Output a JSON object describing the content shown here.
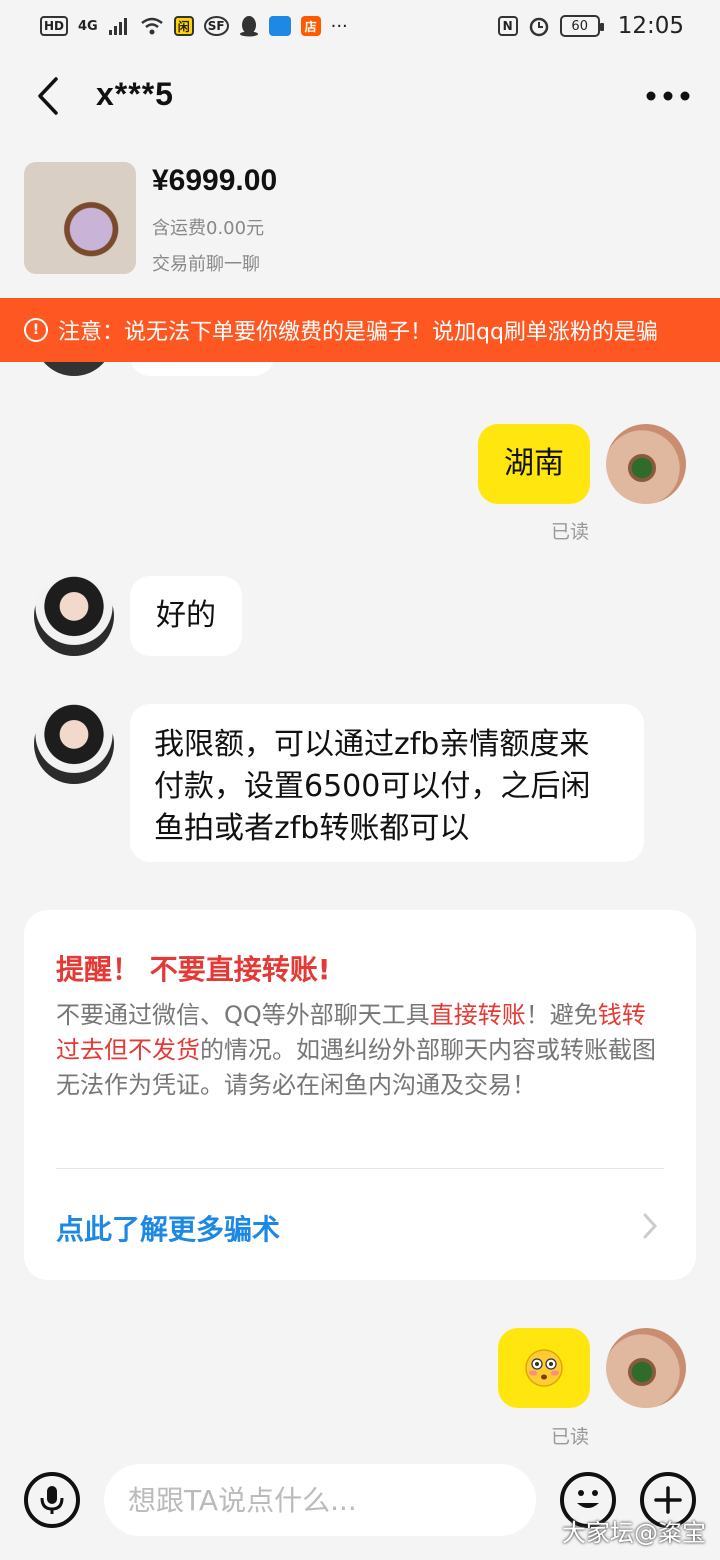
{
  "status_bar": {
    "left_icons": [
      "HD",
      "4G",
      "signal-icon",
      "wifi-icon",
      "闲",
      "SF",
      "qq-icon",
      "app-icon",
      "店",
      "more-dots-icon"
    ],
    "hd": "HD",
    "net": "4G",
    "app1": "闲",
    "app2": "SF",
    "app3": "店",
    "dots": "···",
    "nfc": "N",
    "battery": "60",
    "time": "12:05"
  },
  "header": {
    "title": "x***5"
  },
  "product": {
    "price": "¥6999.00",
    "shipping": "含运费0.00元",
    "hint": "交易前聊一聊"
  },
  "warning": {
    "text": "注意：说无法下单要你缴费的是骗子！说加qq刷单涨粉的是骗"
  },
  "messages": [
    {
      "from": "me",
      "text": "湖南",
      "status": "已读"
    },
    {
      "from": "her",
      "text": "好的"
    },
    {
      "from": "her",
      "lines": [
        "我限额，可以通过zfb亲情额度来",
        "付款，设置6500可以付，之后闲",
        "鱼拍或者zfb转账都可以"
      ]
    },
    {
      "from": "me",
      "emoji": "😳",
      "status": "已读"
    }
  ],
  "reminder": {
    "title": "提醒！ 不要直接转账!",
    "body_part1": "不要通过微信、QQ等外部聊天工具",
    "body_hl1": "直接转账",
    "body_part2": "！避免",
    "body_hl2": "钱转过去但不发货",
    "body_part3": "的情况。如遇纠纷外部聊天内容或转账截图无法作为凭证。请务必在闲鱼内沟通及交易！",
    "link": "点此了解更多骗术"
  },
  "input": {
    "placeholder": "想跟TA说点什么..."
  },
  "watermark": "大家坛@粢宝",
  "colors": {
    "accent_yellow": "#ffe60f",
    "warning_orange": "#ff5722",
    "alert_red": "#e53935",
    "link_blue": "#1e88e5"
  }
}
